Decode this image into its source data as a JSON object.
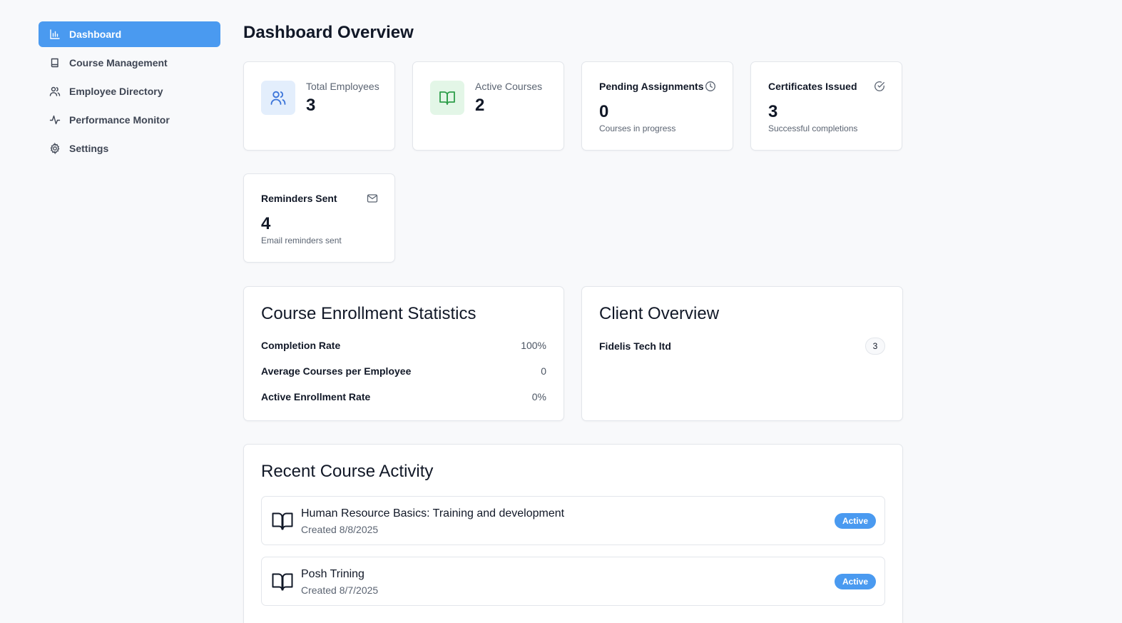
{
  "sidebar": {
    "items": [
      {
        "label": "Dashboard",
        "icon": "bar-chart-icon",
        "active": true
      },
      {
        "label": "Course Management",
        "icon": "book-icon",
        "active": false
      },
      {
        "label": "Employee Directory",
        "icon": "users-icon",
        "active": false
      },
      {
        "label": "Performance Monitor",
        "icon": "activity-icon",
        "active": false
      },
      {
        "label": "Settings",
        "icon": "gear-icon",
        "active": false
      }
    ]
  },
  "main": {
    "title": "Dashboard Overview",
    "stats": {
      "total_employees": {
        "label": "Total Employees",
        "value": "3",
        "icon": "users-icon",
        "color": "#3b74d9",
        "bg": "#e3eefc"
      },
      "active_courses": {
        "label": "Active Courses",
        "value": "2",
        "icon": "book-open-icon",
        "color": "#2e9e4a",
        "bg": "#e3f6e7"
      },
      "pending_assignments": {
        "label": "Pending Assignments",
        "value": "0",
        "sub": "Courses in progress",
        "icon": "clock-icon"
      },
      "certificates_issued": {
        "label": "Certificates Issued",
        "value": "3",
        "sub": "Successful completions",
        "icon": "check-circle-icon"
      },
      "reminders_sent": {
        "label": "Reminders Sent",
        "value": "4",
        "sub": "Email reminders sent",
        "icon": "mail-icon"
      }
    },
    "enrollment": {
      "title": "Course Enrollment Statistics",
      "rows": [
        {
          "label": "Completion Rate",
          "value": "100%"
        },
        {
          "label": "Average Courses per Employee",
          "value": "0"
        },
        {
          "label": "Active Enrollment Rate",
          "value": "0%"
        }
      ]
    },
    "clients": {
      "title": "Client Overview",
      "items": [
        {
          "name": "Fidelis Tech ltd",
          "count": "3"
        }
      ]
    },
    "activity": {
      "title": "Recent Course Activity",
      "items": [
        {
          "title": "Human Resource Basics: Training and development",
          "date": "Created 8/8/2025",
          "status": "Active"
        },
        {
          "title": "Posh Trining",
          "date": "Created 8/7/2025",
          "status": "Active"
        }
      ]
    }
  },
  "colors": {
    "accent": "#4a9af0",
    "background": "#f8f9fb",
    "card_border": "#e3e6eb"
  }
}
